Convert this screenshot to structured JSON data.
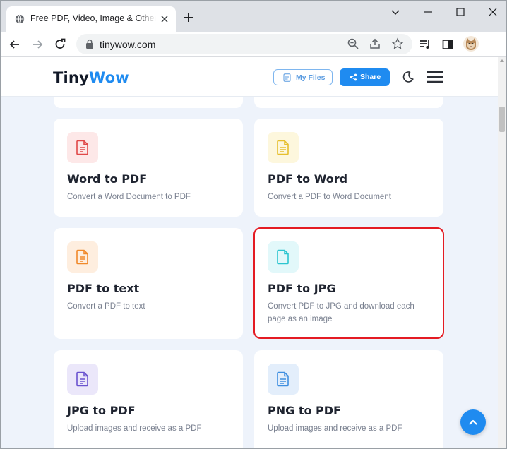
{
  "browser": {
    "tab_title": "Free PDF, Video, Image & Other Online Tools",
    "url": "tinywow.com",
    "icons": [
      "globe-icon",
      "close-icon",
      "plus-icon",
      "minimize-icon",
      "maximize-icon",
      "window-close-icon",
      "back-icon",
      "forward-icon",
      "reload-icon",
      "lock-icon",
      "zoom-icon",
      "share-icon",
      "star-icon",
      "media-icon",
      "sidepanel-icon",
      "avatar"
    ]
  },
  "header": {
    "logo_part1": "Tiny",
    "logo_part2": "Wow",
    "my_files_label": "My Files",
    "share_label": "Share",
    "icons": [
      "file-icon",
      "share-icon",
      "moon-icon",
      "hamburger-menu-icon"
    ]
  },
  "tools": [
    {
      "title": "Word to PDF",
      "description": "Convert a Word Document to PDF",
      "icon": "document-icon",
      "icon_color": "#e04848",
      "icon_bg": "#fde8e8"
    },
    {
      "title": "PDF to Word",
      "description": "Convert a PDF to Word Document",
      "icon": "document-icon",
      "icon_color": "#e6bf2e",
      "icon_bg": "#fdf7dd"
    },
    {
      "title": "PDF to text",
      "description": "Convert a PDF to text",
      "icon": "document-icon",
      "icon_color": "#f0892a",
      "icon_bg": "#feeedf"
    },
    {
      "title": "PDF to JPG",
      "description": "Convert PDF to JPG and download each page as an image",
      "icon": "blank-document-icon",
      "icon_color": "#2cc5cf",
      "icon_bg": "#e2f8fa",
      "highlighted": true
    },
    {
      "title": "JPG to PDF",
      "description": "Upload images and receive as a PDF",
      "icon": "document-icon",
      "icon_color": "#6a53cf",
      "icon_bg": "#ebe7fa"
    },
    {
      "title": "PNG to PDF",
      "description": "Upload images and receive as a PDF",
      "icon": "document-icon",
      "icon_color": "#3f8fe0",
      "icon_bg": "#e3eefb"
    }
  ],
  "colors": {
    "accent": "#1f8bf0",
    "highlight_border": "#e41b23",
    "page_bg": "#eef3fb"
  },
  "scroll_top_icon": "arrow-up-icon"
}
